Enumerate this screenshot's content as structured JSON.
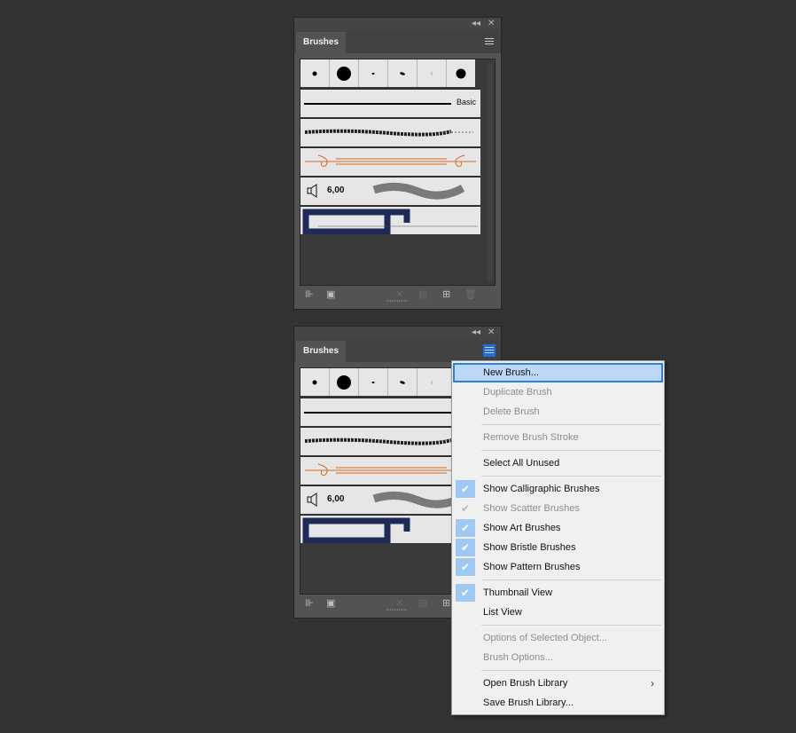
{
  "panel": {
    "tab_label": "Brushes",
    "collapse_glyph": "◂◂",
    "close_glyph": "✕",
    "basic_label": "Basic",
    "sound_value": "6,00",
    "footer_icons": [
      "libraries-menu-icon",
      "libraries-panel-icon",
      "remove-stroke-icon",
      "options-icon",
      "new-brush-icon",
      "delete-brush-icon"
    ]
  },
  "menu": {
    "items": [
      {
        "label": "New Brush...",
        "enabled": true,
        "checked": false,
        "highlighted": true
      },
      {
        "label": "Duplicate Brush",
        "enabled": false,
        "checked": false
      },
      {
        "label": "Delete Brush",
        "enabled": false,
        "checked": false
      },
      {
        "label": "Remove Brush Stroke",
        "enabled": false,
        "checked": false
      },
      {
        "label": "Select All Unused",
        "enabled": true,
        "checked": false
      },
      {
        "label": "Show Calligraphic Brushes",
        "enabled": true,
        "checked": true
      },
      {
        "label": "Show Scatter Brushes",
        "enabled": false,
        "checked": true
      },
      {
        "label": "Show Art Brushes",
        "enabled": true,
        "checked": true
      },
      {
        "label": "Show Bristle Brushes",
        "enabled": true,
        "checked": true
      },
      {
        "label": "Show Pattern Brushes",
        "enabled": true,
        "checked": true
      },
      {
        "label": "Thumbnail View",
        "enabled": true,
        "checked": true
      },
      {
        "label": "List View",
        "enabled": true,
        "checked": false
      },
      {
        "label": "Options of Selected Object...",
        "enabled": false,
        "checked": false
      },
      {
        "label": "Brush Options...",
        "enabled": false,
        "checked": false
      },
      {
        "label": "Open Brush Library",
        "enabled": true,
        "checked": false,
        "submenu": true
      },
      {
        "label": "Save Brush Library...",
        "enabled": true,
        "checked": false
      }
    ],
    "submenu_glyph": "›",
    "check_glyph": "✔"
  },
  "colors": {
    "background": "#323232",
    "panel": "#535353",
    "highlight": "#2f7fdd",
    "check_bg": "#9ec9f3",
    "art_brush_orange": "#d9691e",
    "pattern_navy": "#1e2a57"
  }
}
